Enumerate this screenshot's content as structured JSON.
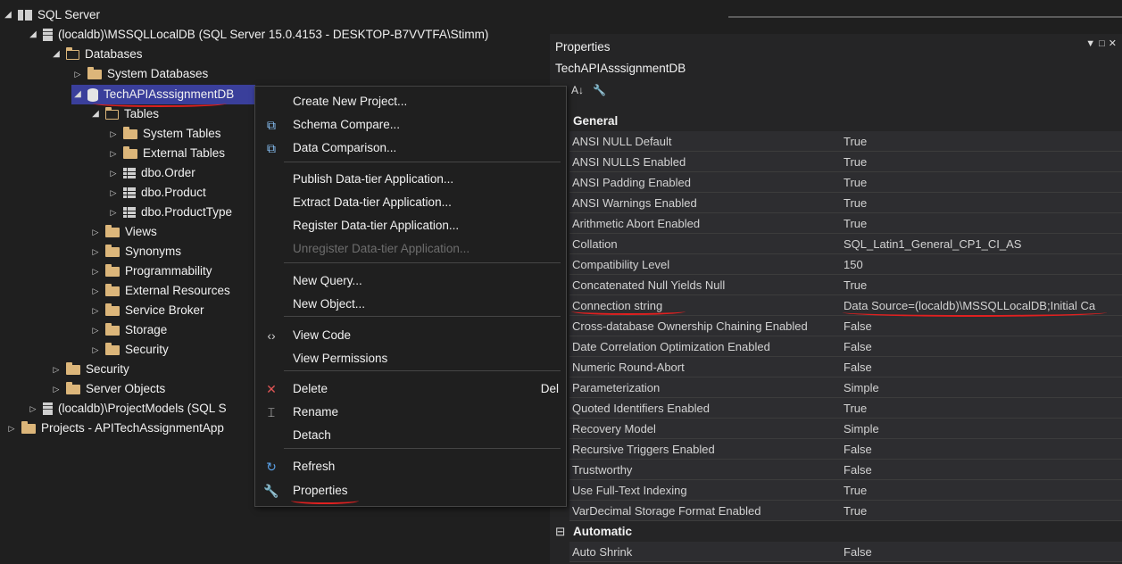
{
  "tree": {
    "root": "SQL Server",
    "localdb": "(localdb)\\MSSQLLocalDB (SQL Server 15.0.4153 - DESKTOP-B7VVTFA\\Stimm)",
    "databases": "Databases",
    "system_databases": "System Databases",
    "selected_db": "TechAPIAsssignmentDB",
    "tables": "Tables",
    "system_tables": "System Tables",
    "external_tables": "External Tables",
    "t_order": "dbo.Order",
    "t_product": "dbo.Product",
    "t_producttype": "dbo.ProductType",
    "views": "Views",
    "synonyms": "Synonyms",
    "programmability": "Programmability",
    "external_resources": "External Resources",
    "service_broker": "Service Broker",
    "storage": "Storage",
    "db_security": "Security",
    "security": "Security",
    "server_objects": "Server Objects",
    "projectmodels": "(localdb)\\ProjectModels (SQL S",
    "projects": "Projects - APITechAssignmentApp"
  },
  "menu": {
    "items": [
      {
        "label": "Create New Project...",
        "icon": "",
        "shortcut": ""
      },
      {
        "label": "Schema Compare...",
        "icon": "schema-compare-icon",
        "shortcut": ""
      },
      {
        "label": "Data Comparison...",
        "icon": "data-compare-icon",
        "shortcut": ""
      },
      {
        "label": "Publish Data-tier Application...",
        "icon": "",
        "shortcut": ""
      },
      {
        "label": "Extract Data-tier Application...",
        "icon": "",
        "shortcut": ""
      },
      {
        "label": "Register Data-tier Application...",
        "icon": "",
        "shortcut": ""
      },
      {
        "label": "Unregister Data-tier Application...",
        "icon": "",
        "shortcut": "",
        "disabled": true
      },
      {
        "label": "New Query...",
        "icon": "",
        "shortcut": ""
      },
      {
        "label": "New Object...",
        "icon": "",
        "shortcut": ""
      },
      {
        "label": "View Code",
        "icon": "code-icon",
        "shortcut": ""
      },
      {
        "label": "View Permissions",
        "icon": "",
        "shortcut": ""
      },
      {
        "label": "Delete",
        "icon": "delete-icon",
        "shortcut": "Del"
      },
      {
        "label": "Rename",
        "icon": "rename-icon",
        "shortcut": ""
      },
      {
        "label": "Detach",
        "icon": "",
        "shortcut": ""
      },
      {
        "label": "Refresh",
        "icon": "refresh-icon",
        "shortcut": ""
      },
      {
        "label": "Properties",
        "icon": "wrench-icon",
        "shortcut": ""
      }
    ]
  },
  "properties": {
    "title": "Properties",
    "object": "TechAPIAsssignmentDB",
    "categories": {
      "general": "General",
      "automatic": "Automatic"
    },
    "general_rows": [
      {
        "name": "ANSI NULL Default",
        "value": "True"
      },
      {
        "name": "ANSI NULLS Enabled",
        "value": "True"
      },
      {
        "name": "ANSI Padding Enabled",
        "value": "True"
      },
      {
        "name": "ANSI Warnings Enabled",
        "value": "True"
      },
      {
        "name": "Arithmetic Abort Enabled",
        "value": "True"
      },
      {
        "name": "Collation",
        "value": "SQL_Latin1_General_CP1_CI_AS"
      },
      {
        "name": "Compatibility Level",
        "value": "150"
      },
      {
        "name": "Concatenated Null Yields Null",
        "value": "True"
      },
      {
        "name": "Connection string",
        "value": "Data Source=(localdb)\\MSSQLLocalDB;Initial Ca"
      },
      {
        "name": "Cross-database Ownership Chaining Enabled",
        "value": "False"
      },
      {
        "name": "Date Correlation Optimization Enabled",
        "value": "False"
      },
      {
        "name": "Numeric Round-Abort",
        "value": "False"
      },
      {
        "name": "Parameterization",
        "value": "Simple"
      },
      {
        "name": "Quoted Identifiers Enabled",
        "value": "True"
      },
      {
        "name": "Recovery Model",
        "value": "Simple"
      },
      {
        "name": "Recursive Triggers Enabled",
        "value": "False"
      },
      {
        "name": "Trustworthy",
        "value": "False"
      },
      {
        "name": "Use Full-Text Indexing",
        "value": "True"
      },
      {
        "name": "VarDecimal Storage Format Enabled",
        "value": "True"
      }
    ],
    "automatic_rows": [
      {
        "name": "Auto Shrink",
        "value": "False"
      }
    ]
  },
  "colors": {
    "selection": "#3a3f9b",
    "annotation": "#e02020",
    "folder": "#dcb67a"
  }
}
